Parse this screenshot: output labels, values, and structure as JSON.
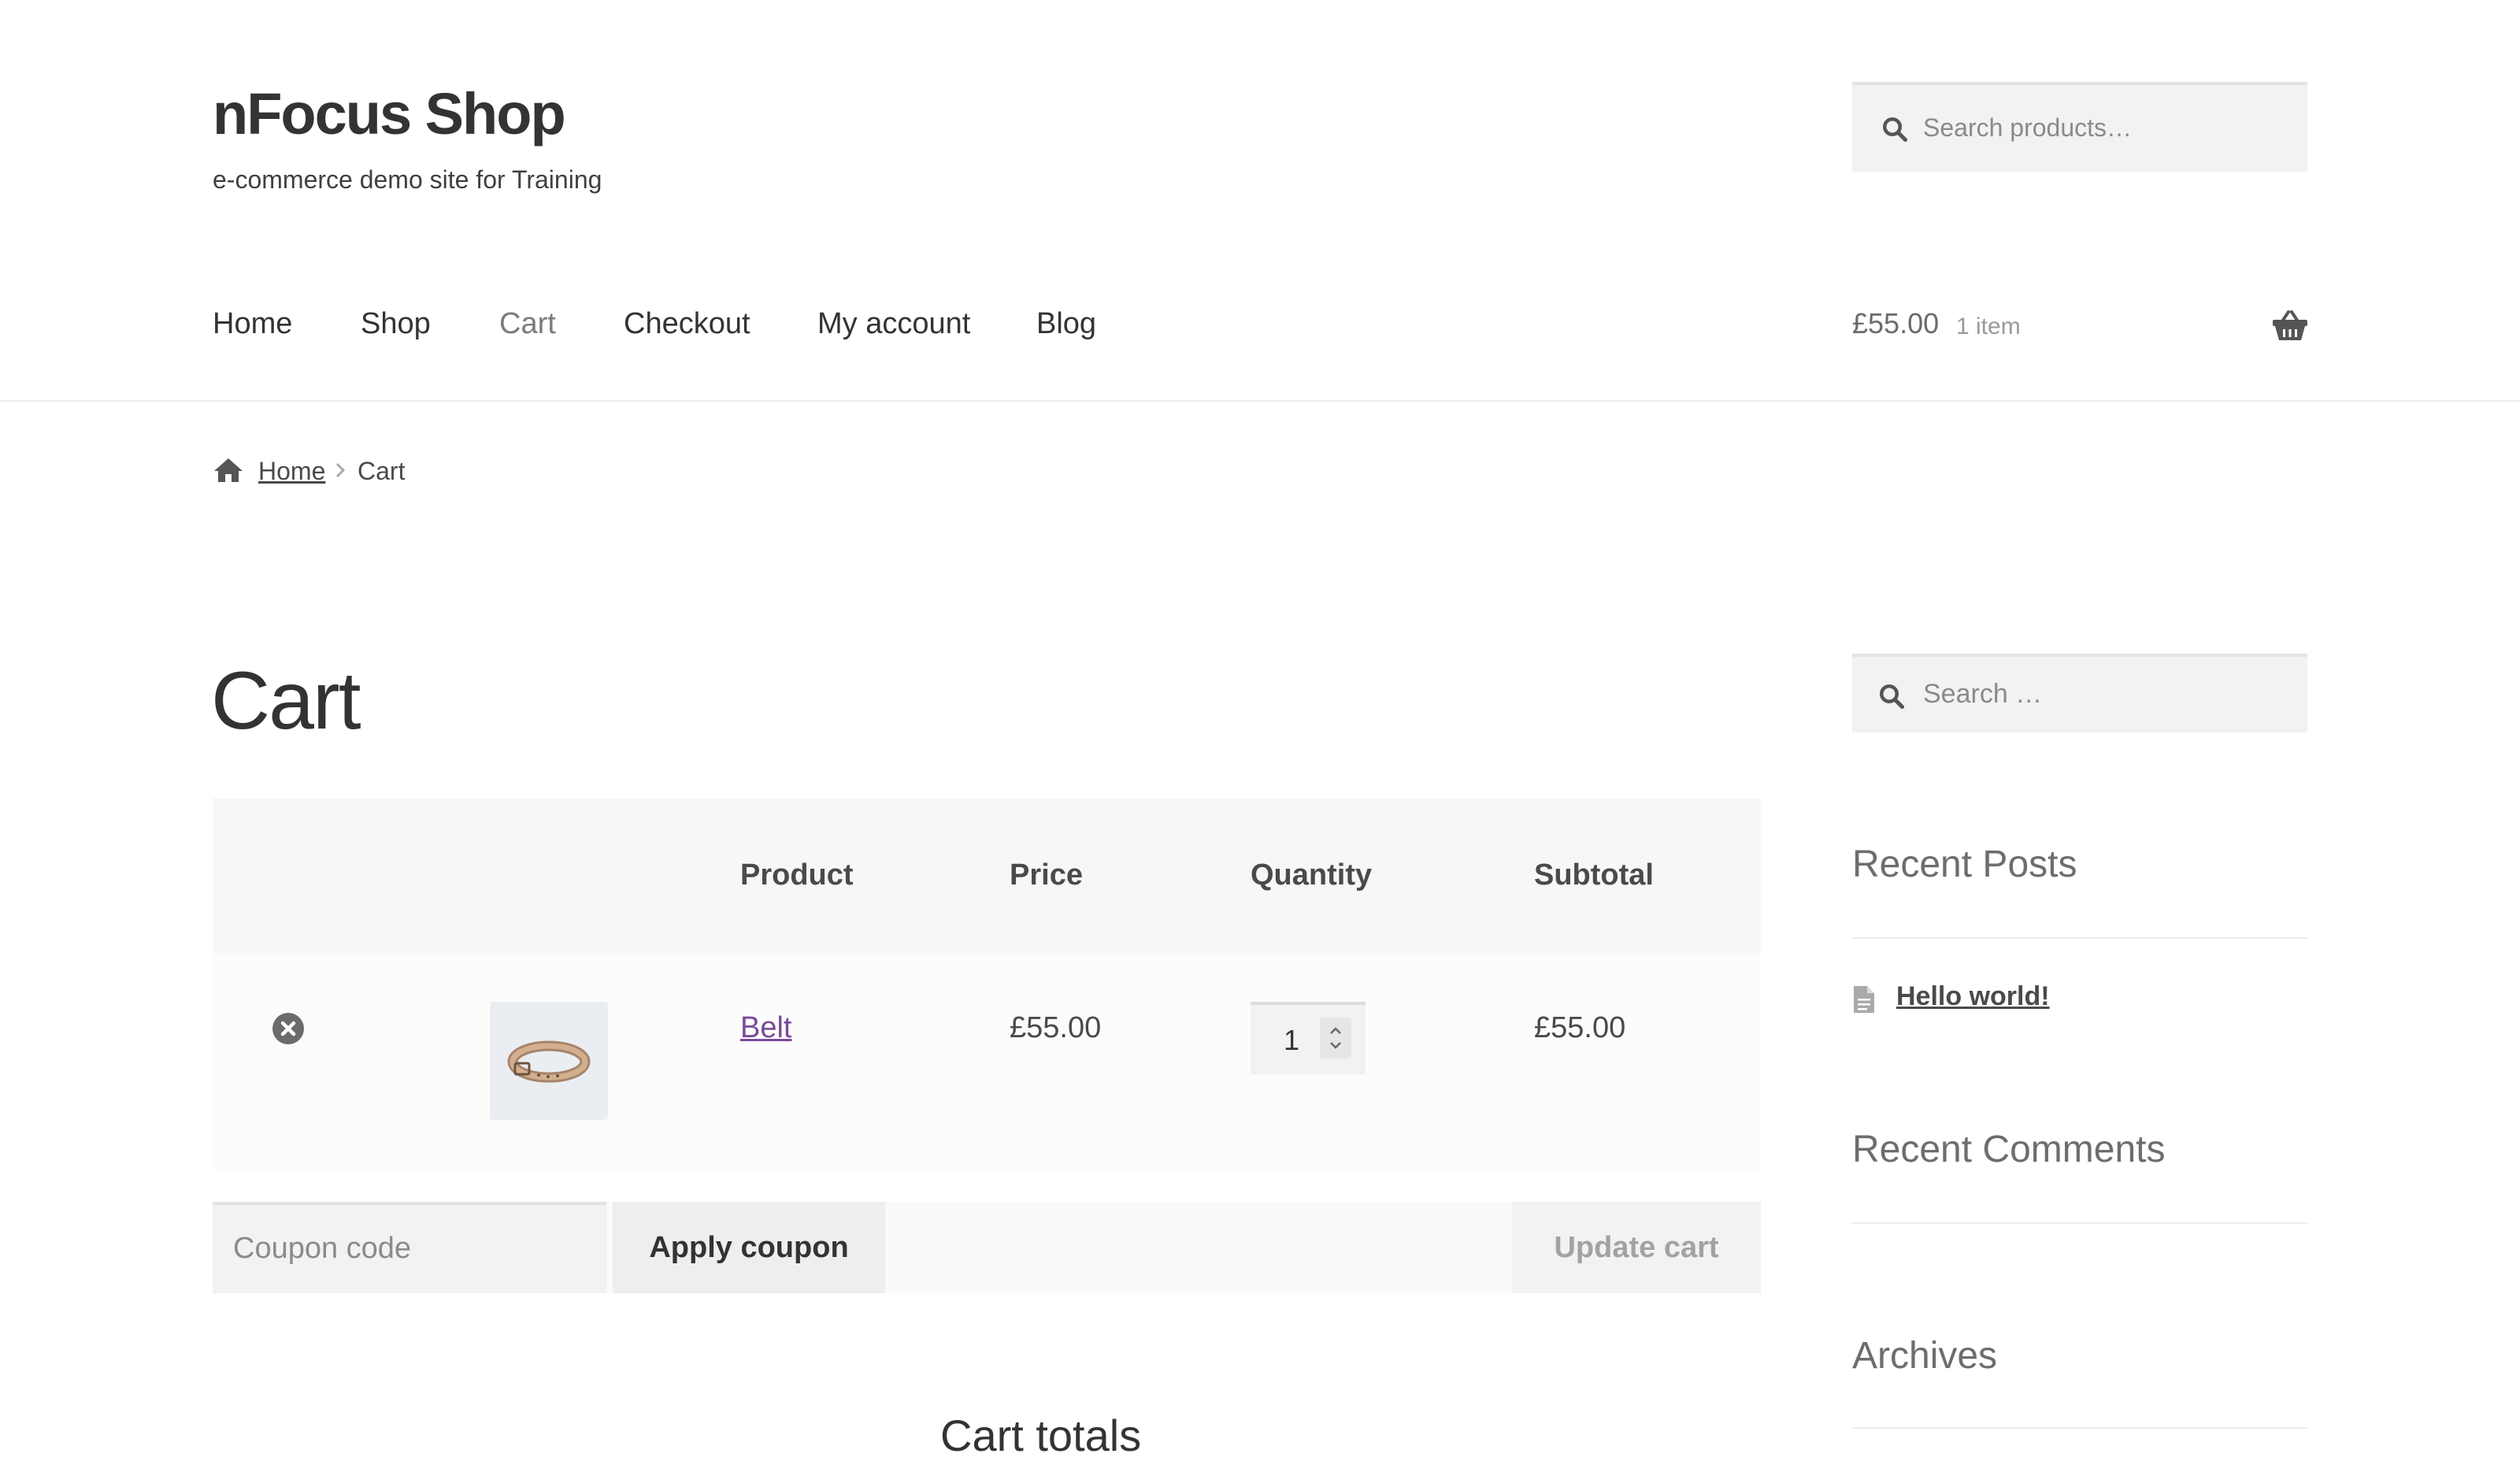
{
  "site": {
    "title": "nFocus Shop",
    "tagline": "e-commerce demo site for Training"
  },
  "header_search": {
    "placeholder": "Search products…",
    "icon": "search-icon"
  },
  "nav": {
    "items": [
      "Home",
      "Shop",
      "Cart",
      "Checkout",
      "My account",
      "Blog"
    ],
    "active": "Cart"
  },
  "mini_cart": {
    "amount": "£55.00",
    "count": "1 item",
    "icon": "basket-icon"
  },
  "breadcrumb": {
    "home": "Home",
    "current": "Cart",
    "icon": "home-icon"
  },
  "page_title": "Cart",
  "cart_table": {
    "headers": {
      "product": "Product",
      "price": "Price",
      "quantity": "Quantity",
      "subtotal": "Subtotal"
    },
    "rows": [
      {
        "product": "Belt",
        "price": "£55.00",
        "quantity": "1",
        "subtotal": "£55.00"
      }
    ]
  },
  "coupon": {
    "placeholder": "Coupon code",
    "apply_label": "Apply coupon"
  },
  "update_cart_label": "Update cart",
  "cart_totals_title": "Cart totals",
  "sidebar": {
    "search_placeholder": "Search …",
    "recent_posts_title": "Recent Posts",
    "posts": [
      "Hello world!"
    ],
    "recent_comments_title": "Recent Comments",
    "archives_title": "Archives"
  },
  "colors": {
    "text": "#43454b",
    "link_visited": "#7a4a9a",
    "table_header_bg": "#f7f7f7",
    "input_bg": "#f2f2f2"
  }
}
